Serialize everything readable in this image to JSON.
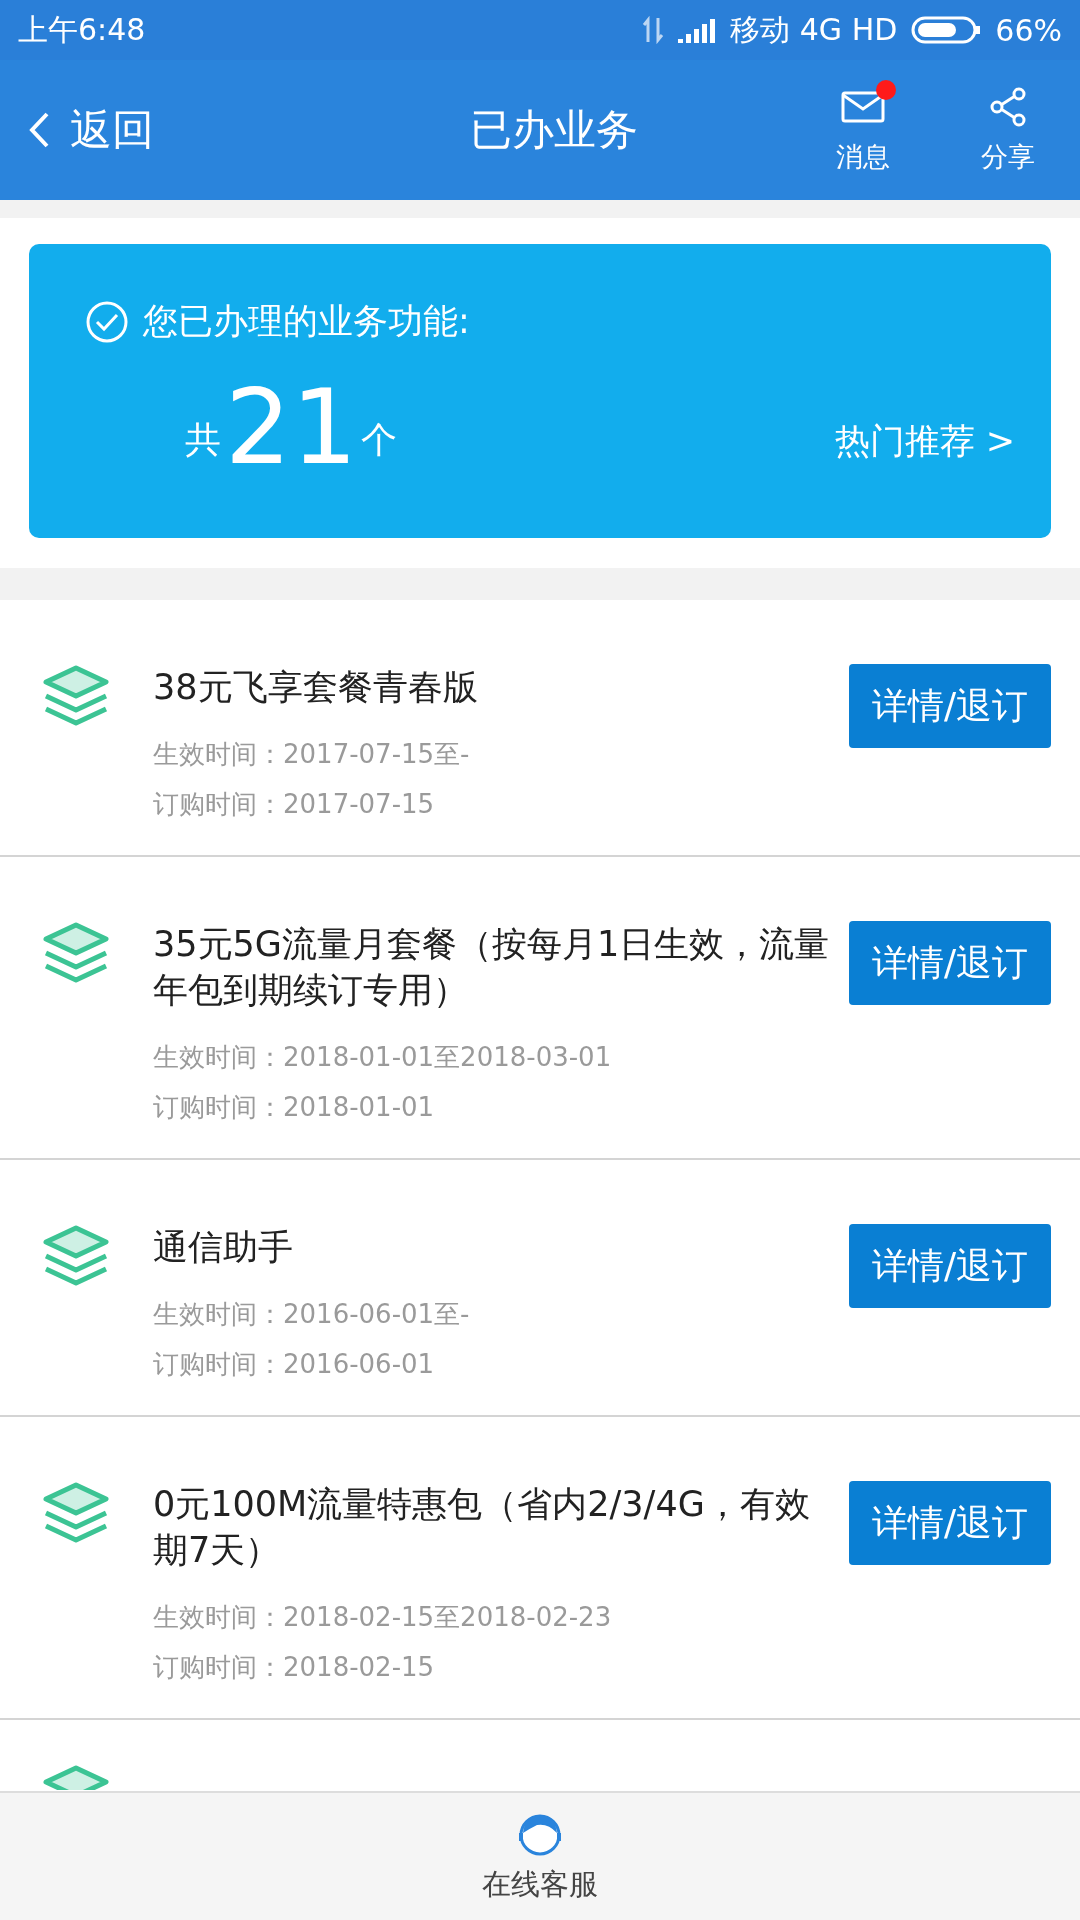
{
  "status_bar": {
    "time": "上午6:48",
    "carrier": "移动 4G HD",
    "battery": "66%"
  },
  "header": {
    "back": "返回",
    "title": "已办业务",
    "actions": [
      {
        "kind": "message",
        "label": "消息",
        "unread": true
      },
      {
        "kind": "share",
        "label": "分享",
        "unread": false
      }
    ]
  },
  "summary": {
    "heading": "您已办理的业务功能:",
    "prefix": "共",
    "count": "21",
    "suffix": "个",
    "link": "热门推荐 >"
  },
  "services": [
    {
      "name": "38元飞享套餐青春版",
      "effective": "生效时间：2017-07-15至-",
      "ordered": "订购时间：2017-07-15",
      "button": "详情/退订"
    },
    {
      "name": "35元5G流量月套餐（按每月1日生效，流量年包到期续订专用）",
      "effective": "生效时间：2018-01-01至2018-03-01",
      "ordered": "订购时间：2018-01-01",
      "button": "详情/退订"
    },
    {
      "name": "通信助手",
      "effective": "生效时间：2016-06-01至-",
      "ordered": "订购时间：2016-06-01",
      "button": "详情/退订"
    },
    {
      "name": "0元100M流量特惠包（省内2/3/4G，有效期7天）",
      "effective": "生效时间：2018-02-15至2018-02-23",
      "ordered": "订购时间：2018-02-15",
      "button": "详情/退订"
    }
  ],
  "footer": {
    "label": "在线客服"
  }
}
